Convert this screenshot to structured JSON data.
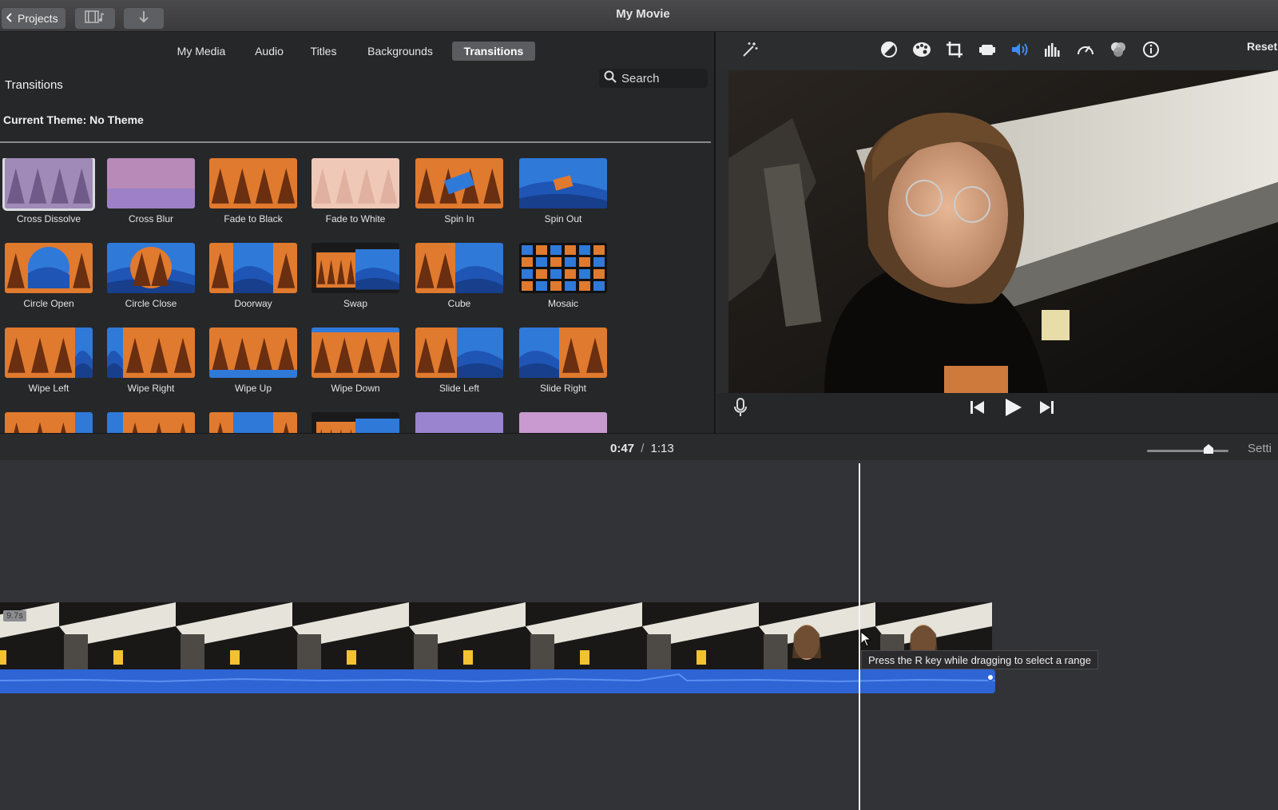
{
  "window": {
    "title": "My Movie"
  },
  "topbar": {
    "projects_label": "Projects",
    "back_icon": "chevron-left-icon",
    "media_icon": "filmstrip-music-icon",
    "import_icon": "arrow-down-icon"
  },
  "browser": {
    "tabs": [
      {
        "label": "My Media",
        "active": false
      },
      {
        "label": "Audio",
        "active": false
      },
      {
        "label": "Titles",
        "active": false
      },
      {
        "label": "Backgrounds",
        "active": false
      },
      {
        "label": "Transitions",
        "active": true
      }
    ],
    "section_title": "Transitions",
    "search_label": "Search",
    "current_theme": "Current Theme: No Theme",
    "transitions": [
      {
        "label": "Cross Dissolve",
        "selected": true,
        "style": "dissolve"
      },
      {
        "label": "Cross Blur",
        "selected": false,
        "style": "blur"
      },
      {
        "label": "Fade to Black",
        "selected": false,
        "style": "forest"
      },
      {
        "label": "Fade to White",
        "selected": false,
        "style": "white"
      },
      {
        "label": "Spin In",
        "selected": false,
        "style": "spinin"
      },
      {
        "label": "Spin Out",
        "selected": false,
        "style": "spinout"
      },
      {
        "label": "Circle Open",
        "selected": false,
        "style": "circleopen"
      },
      {
        "label": "Circle Close",
        "selected": false,
        "style": "circleclose"
      },
      {
        "label": "Doorway",
        "selected": false,
        "style": "doorway"
      },
      {
        "label": "Swap",
        "selected": false,
        "style": "swap"
      },
      {
        "label": "Cube",
        "selected": false,
        "style": "cube"
      },
      {
        "label": "Mosaic",
        "selected": false,
        "style": "mosaic"
      },
      {
        "label": "Wipe Left",
        "selected": false,
        "style": "wipeleft"
      },
      {
        "label": "Wipe Right",
        "selected": false,
        "style": "wiperight"
      },
      {
        "label": "Wipe Up",
        "selected": false,
        "style": "wipeup"
      },
      {
        "label": "Wipe Down",
        "selected": false,
        "style": "wipedown"
      },
      {
        "label": "Slide Left",
        "selected": false,
        "style": "slideleft"
      },
      {
        "label": "Slide Right",
        "selected": false,
        "style": "slideright"
      }
    ],
    "partial_row": [
      "wipeleft",
      "wiperight",
      "doorway",
      "swap",
      "purple",
      "pink"
    ]
  },
  "viewer": {
    "tool_icons": [
      "magic-wand-icon",
      "color-balance-icon",
      "color-palette-icon",
      "crop-icon",
      "stabilization-camera-icon",
      "volume-icon",
      "equalizer-icon",
      "speed-icon",
      "filter-icon",
      "info-icon"
    ],
    "reset_label": "Reset",
    "controls": {
      "mic_icon": "microphone-icon",
      "prev_icon": "skip-back-icon",
      "play_icon": "play-icon",
      "next_icon": "skip-forward-icon"
    }
  },
  "timeline": {
    "current_time": "0:47",
    "separator": "/",
    "total_time": "1:13",
    "settings_label": "Setti",
    "clip_duration": "9.7s",
    "tooltip": "Press the R key while dragging to select a range",
    "zoom_level": 0.75
  },
  "colors": {
    "accent": "#2e64d4",
    "orange": "#e07a2e",
    "blue": "#2f79d9",
    "background": "#2b2c2e"
  }
}
